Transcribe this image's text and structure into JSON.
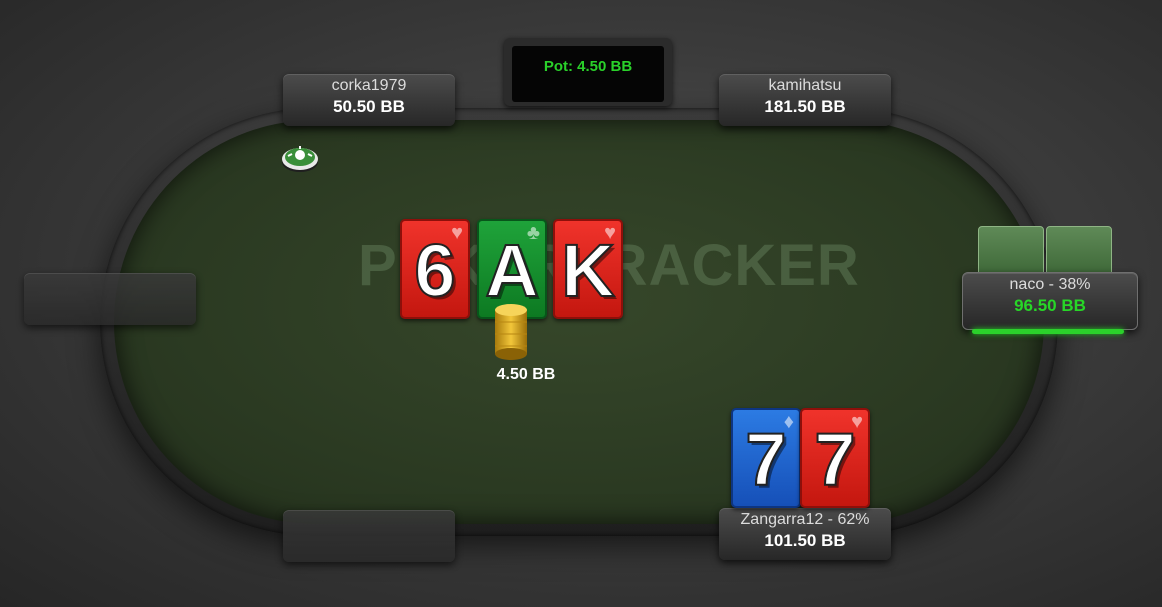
{
  "pot": {
    "label": "Pot: 4.50 BB"
  },
  "watermark": {
    "text": "POKERTRACKER"
  },
  "board": {
    "cards": [
      {
        "rank": "6",
        "suit": "♥",
        "suit_name": "hearts",
        "color": "#e2231a"
      },
      {
        "rank": "A",
        "suit": "♣",
        "suit_name": "clubs",
        "color": "#159a30"
      },
      {
        "rank": "K",
        "suit": "♥",
        "suit_name": "hearts",
        "color": "#e2231a"
      }
    ]
  },
  "bet": {
    "amount": "4.50 BB"
  },
  "seats": [
    {
      "position": "top-left",
      "name": "corka1979",
      "stack": "50.50 BB"
    },
    {
      "position": "top-right",
      "name": "kamihatsu",
      "stack": "181.50 BB"
    },
    {
      "position": "right",
      "name": "naco - 38%",
      "stack": "96.50 BB",
      "active": true,
      "stack_color": "#27d627"
    },
    {
      "position": "bottom-right",
      "name": "Zangarra12 - 62%",
      "stack": "101.50 BB"
    },
    {
      "position": "left",
      "name": "",
      "stack": ""
    },
    {
      "position": "bottom-left",
      "name": "",
      "stack": ""
    }
  ],
  "hero_cards": [
    {
      "rank": "7",
      "suit": "♦",
      "suit_name": "diamonds",
      "color": "#1f66d6"
    },
    {
      "rank": "7",
      "suit": "♥",
      "suit_name": "hearts",
      "color": "#e2231a"
    }
  ],
  "icons": {
    "dealer": "dealer-button-icon",
    "chips": "chip-stack-icon",
    "card_back": "card-back-icon"
  }
}
